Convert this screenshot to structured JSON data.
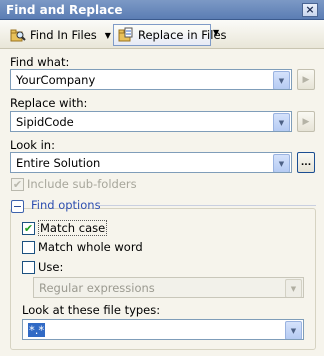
{
  "window": {
    "title": "Find and Replace"
  },
  "toolbar": {
    "find_in_files": {
      "label": "Find In Files"
    },
    "replace_in_files": {
      "label": "Replace in Files"
    }
  },
  "form": {
    "find_what": {
      "label": "Find what:",
      "value": "YourCompany"
    },
    "replace_with": {
      "label": "Replace with:",
      "value": "SipidCode"
    },
    "look_in": {
      "label": "Look in:",
      "value": "Entire Solution",
      "browse_label": "..."
    },
    "include_subfolders": {
      "label": "Include sub-folders",
      "checked": true,
      "enabled": false
    }
  },
  "find_options": {
    "heading": "Find options",
    "match_case": {
      "label": "Match case",
      "checked": true
    },
    "match_whole_word": {
      "label": "Match whole word",
      "checked": false
    },
    "use": {
      "label": "Use:",
      "checked": false
    },
    "use_type": {
      "value": "Regular expressions",
      "enabled": false
    },
    "file_types": {
      "label": "Look at these file types:",
      "value": "*.*"
    }
  }
}
